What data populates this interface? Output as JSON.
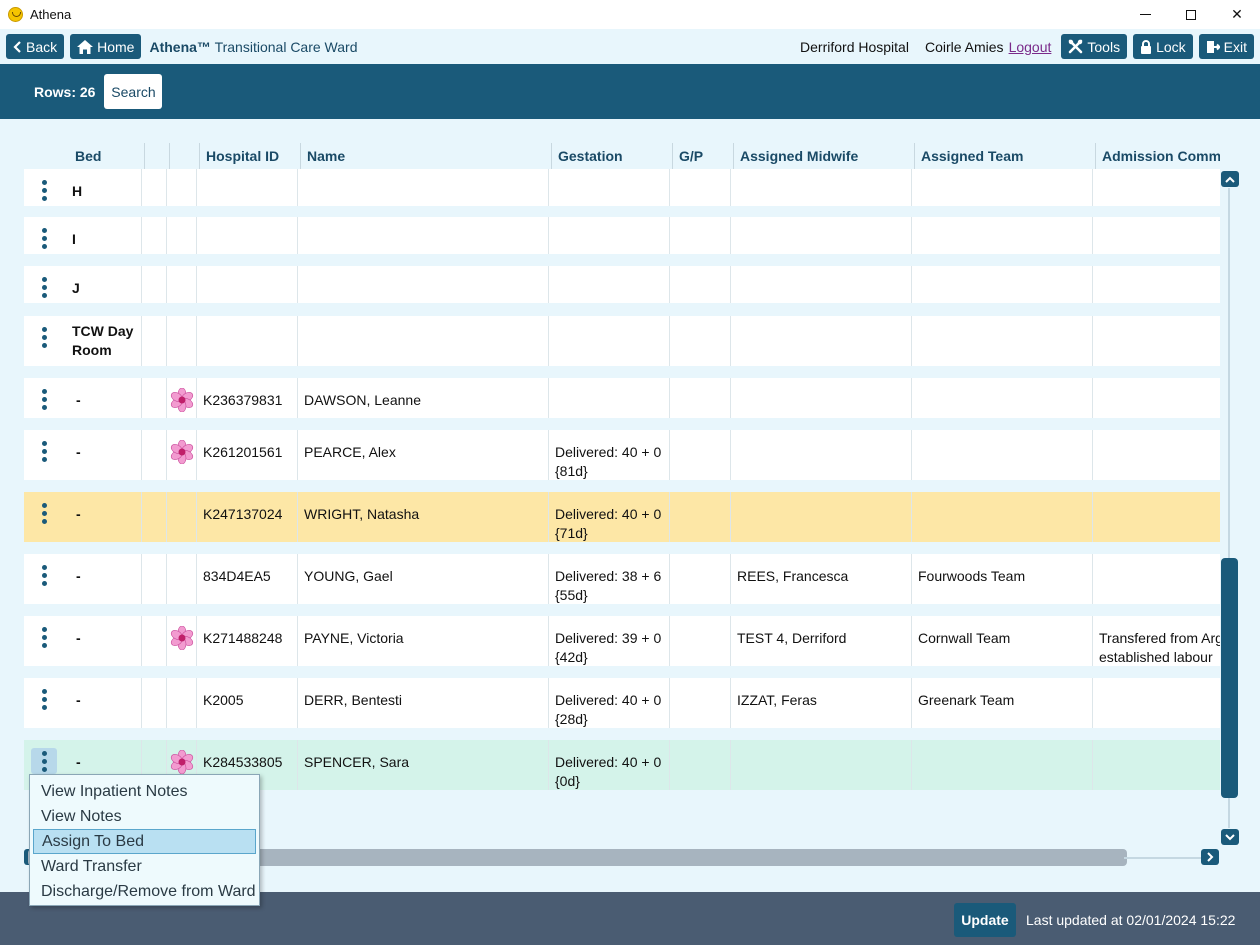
{
  "window": {
    "title": "Athena",
    "minimize": "",
    "maximize": "",
    "close": "✕"
  },
  "nav": {
    "back": "Back",
    "home": "Home",
    "brand": "Athena™",
    "ward": "Transitional Care Ward",
    "hospital": "Derriford Hospital",
    "user": "Coirle Amies",
    "logout": "Logout",
    "tools": "Tools",
    "lock": "Lock",
    "exit": "Exit"
  },
  "toolbar": {
    "rows_label": "Rows: 26",
    "search": "Search"
  },
  "columns": [
    "Bed",
    "",
    "",
    "Hospital ID",
    "Name",
    "Gestation",
    "G/P",
    "Assigned Midwife",
    "Assigned Team",
    "Admission Comm"
  ],
  "rows": [
    {
      "bed": "H",
      "flower": false,
      "id": "",
      "name": "",
      "gest1": "",
      "gest2": "",
      "gp": "",
      "midwife": "",
      "team": "",
      "comment1": "",
      "comment2": "",
      "highlight": ""
    },
    {
      "bed": "I",
      "flower": false,
      "id": "",
      "name": "",
      "gest1": "",
      "gest2": "",
      "gp": "",
      "midwife": "",
      "team": "",
      "comment1": "",
      "comment2": "",
      "highlight": ""
    },
    {
      "bed": "J",
      "flower": false,
      "id": "",
      "name": "",
      "gest1": "",
      "gest2": "",
      "gp": "",
      "midwife": "",
      "team": "",
      "comment1": "",
      "comment2": "",
      "highlight": ""
    },
    {
      "bed": "TCW Day Room",
      "flower": false,
      "id": "",
      "name": "",
      "gest1": "",
      "gest2": "",
      "gp": "",
      "midwife": "",
      "team": "",
      "comment1": "",
      "comment2": "",
      "highlight": ""
    },
    {
      "bed": "-",
      "flower": true,
      "id": "K236379831",
      "name": "DAWSON, Leanne",
      "gest1": "",
      "gest2": "",
      "gp": "",
      "midwife": "",
      "team": "",
      "comment1": "",
      "comment2": "",
      "highlight": ""
    },
    {
      "bed": "-",
      "flower": true,
      "id": "K261201561",
      "name": "PEARCE, Alex",
      "gest1": "Delivered: 40 + 0",
      "gest2": "{81d}",
      "gp": "",
      "midwife": "",
      "team": "",
      "comment1": "",
      "comment2": "",
      "highlight": ""
    },
    {
      "bed": "-",
      "flower": false,
      "id": "K247137024",
      "name": "WRIGHT, Natasha",
      "gest1": "Delivered: 40 + 0",
      "gest2": "{71d}",
      "gp": "",
      "midwife": "",
      "team": "",
      "comment1": "",
      "comment2": "",
      "highlight": "yellow"
    },
    {
      "bed": "-",
      "flower": false,
      "id": "834D4EA5",
      "name": "YOUNG, Gael",
      "gest1": "Delivered: 38 + 6",
      "gest2": "{55d}",
      "gp": "",
      "midwife": "REES, Francesca",
      "team": "Fourwoods Team",
      "comment1": "",
      "comment2": "",
      "highlight": ""
    },
    {
      "bed": "-",
      "flower": true,
      "id": "K271488248",
      "name": "PAYNE, Victoria",
      "gest1": "Delivered: 39 + 0",
      "gest2": "{42d}",
      "gp": "",
      "midwife": "TEST 4, Derriford",
      "team": "Cornwall Team",
      "comment1": "Transfered from Arg",
      "comment2": "established labour",
      "highlight": ""
    },
    {
      "bed": "-",
      "flower": false,
      "id": "K2005",
      "name": "DERR, Bentesti",
      "gest1": "Delivered: 40 + 0",
      "gest2": "{28d}",
      "gp": "",
      "midwife": "IZZAT, Feras",
      "team": "Greenark Team",
      "comment1": "",
      "comment2": "",
      "highlight": ""
    },
    {
      "bed": "-",
      "flower": true,
      "id": "K284533805",
      "name": "SPENCER, Sara",
      "gest1": "Delivered: 40 + 0",
      "gest2": "{0d}",
      "gp": "",
      "midwife": "",
      "team": "",
      "comment1": "",
      "comment2": "",
      "highlight": "green"
    }
  ],
  "context_menu": {
    "items": [
      "View Inpatient Notes",
      "View Notes",
      "Assign To Bed",
      "Ward Transfer",
      "Discharge/Remove from Ward"
    ],
    "selected_index": 2
  },
  "footer": {
    "update": "Update",
    "last_updated": "Last updated at 02/01/2024 15:22"
  },
  "colors": {
    "primary": "#1a5a7a",
    "background": "#e8f6fc",
    "row_yellow": "#fde7a6",
    "row_green": "#d4f3ea",
    "footer": "#4a5c72"
  }
}
